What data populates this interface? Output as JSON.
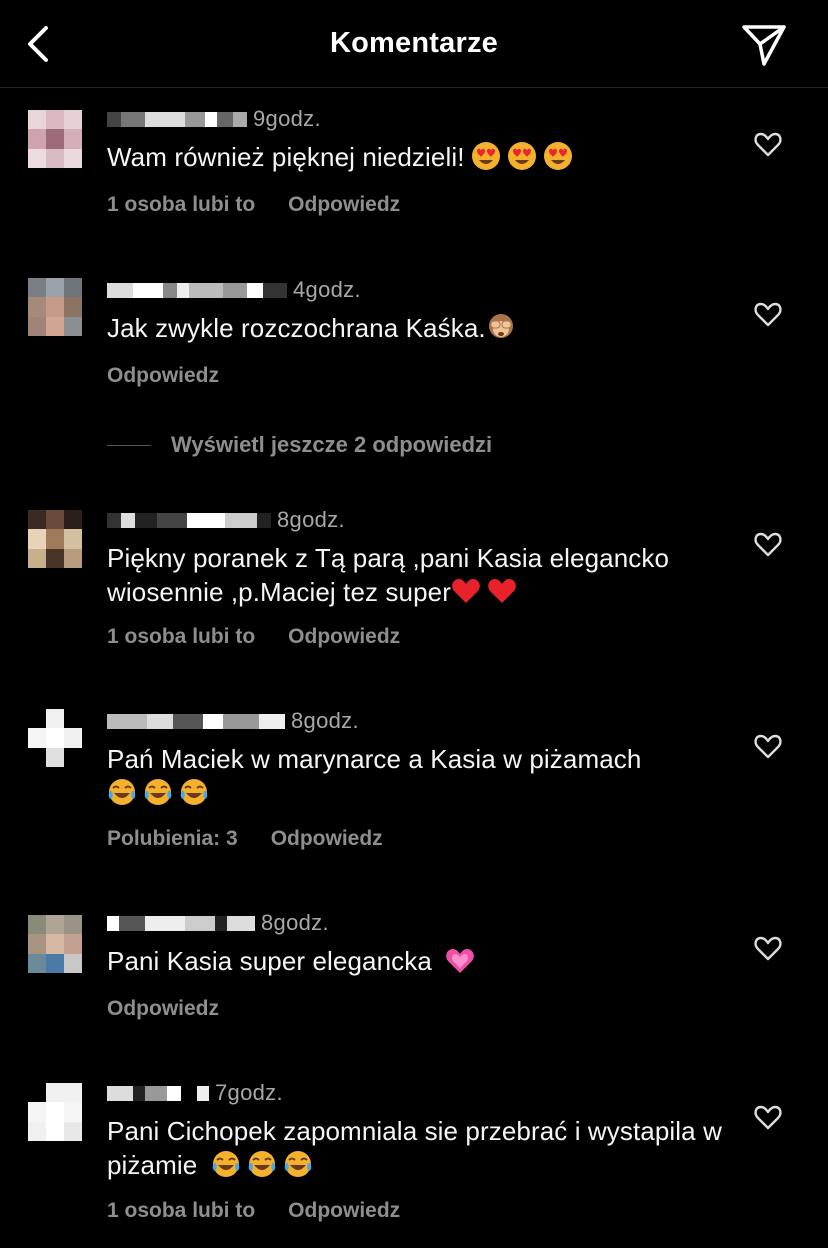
{
  "header": {
    "title": "Komentarze",
    "back_icon": "chevron-left-icon",
    "share_icon": "paper-plane-icon"
  },
  "comments": [
    {
      "time": "9godz.",
      "text": "Wam również pięknej niedzieli!",
      "emojis": [
        "heart-eyes",
        "heart-eyes",
        "heart-eyes"
      ],
      "likes": "1 osoba lubi to",
      "reply": "Odpowiedz"
    },
    {
      "time": "4godz.",
      "text": "Jak zwykle rozczochrana Kaśka.",
      "emojis": [
        "see-no-evil-monkey"
      ],
      "likes": "",
      "reply": "Odpowiedz"
    },
    {
      "time": "8godz.",
      "text": "Piękny poranek z Tą parą ,pani Kasia elegancko wiosennie ,p.Maciej tez super",
      "emojis": [
        "red-heart",
        "red-heart"
      ],
      "likes": "1 osoba lubi to",
      "reply": "Odpowiedz"
    },
    {
      "time": "8godz.",
      "text": "Pań Maciek w marynarce a Kasia w piżamach",
      "emojis": [
        "tears-of-joy",
        "tears-of-joy",
        "tears-of-joy"
      ],
      "likes": "Polubienia: 3",
      "reply": "Odpowiedz"
    },
    {
      "time": "8godz.",
      "text": "Pani Kasia super elegancka ",
      "emojis": [
        "growing-heart"
      ],
      "likes": "",
      "reply": "Odpowiedz"
    },
    {
      "time": "7godz.",
      "text": "Pani Cichopek zapomniala sie przebrać i wystapila w piżamie ",
      "emojis": [
        "tears-of-joy",
        "tears-of-joy",
        "tears-of-joy"
      ],
      "likes": "1 osoba lubi to",
      "reply": "Odpowiedz"
    }
  ],
  "view_replies": {
    "label": "Wyświetl jeszcze 2 odpowiedzi"
  },
  "colors": {
    "background": "#000000",
    "text": "#f5f5f5",
    "secondary": "#8e8e8e",
    "timestamp": "#a8a8a8"
  }
}
